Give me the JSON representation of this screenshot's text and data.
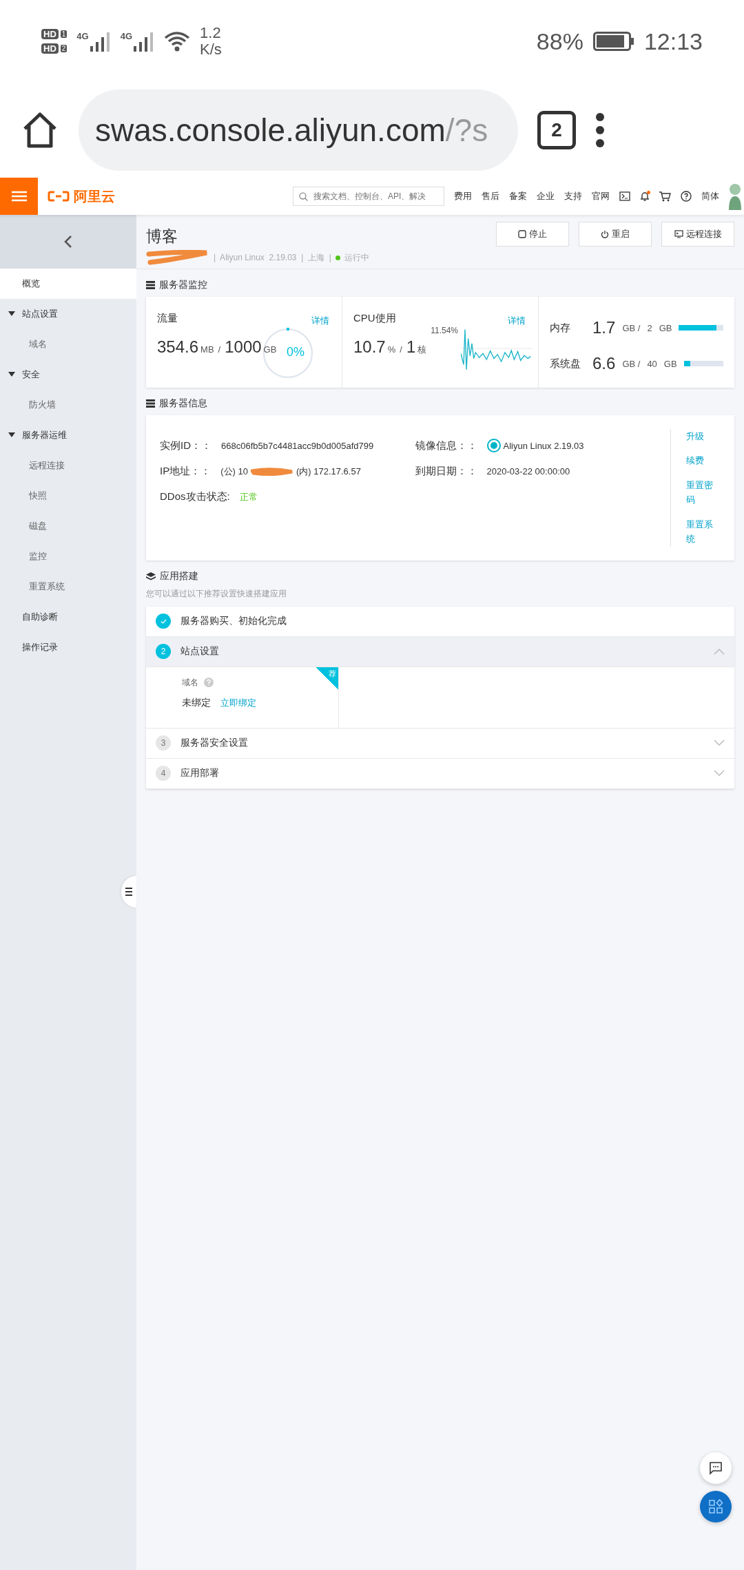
{
  "status_bar": {
    "sims": [
      {
        "badge": "HD",
        "slot": "1",
        "network": "4G"
      },
      {
        "badge": "HD",
        "slot": "2",
        "network": "4G"
      }
    ],
    "speed": "1.2",
    "speed_unit": "K/s",
    "battery": "88%",
    "time": "12:13"
  },
  "browser": {
    "url_host": "swas.console.aliyun.com",
    "url_rest": "/?s",
    "tab_count": "2"
  },
  "header": {
    "logo": "阿里云",
    "search": {
      "placeholder": "搜索文档、控制台、API、解决"
    },
    "nav": [
      "费用",
      "售后",
      "备案",
      "企业",
      "支持",
      "官网"
    ],
    "language": "简体",
    "notification_dot": true
  },
  "sidebar": {
    "items": [
      {
        "label": "概览",
        "selected": true
      },
      {
        "label": "站点设置",
        "selected": false,
        "expanded": true,
        "children": [
          {
            "label": "域名",
            "selected": false
          }
        ]
      },
      {
        "label": "安全",
        "selected": false,
        "expanded": true,
        "children": [
          {
            "label": "防火墙",
            "selected": false
          }
        ]
      },
      {
        "label": "服务器运维",
        "selected": false,
        "expanded": true,
        "children": [
          {
            "label": "远程连接",
            "selected": false
          },
          {
            "label": "快照",
            "selected": false
          },
          {
            "label": "磁盘",
            "selected": false
          },
          {
            "label": "监控",
            "selected": false
          },
          {
            "label": "重置系统",
            "selected": false
          }
        ]
      },
      {
        "label": "自助诊断",
        "selected": false
      },
      {
        "label": "操作记录",
        "selected": false
      }
    ]
  },
  "instance": {
    "title": "博客",
    "meta": "|  Aliyun Linux  2.19.03  |  上海  |",
    "status": "运行中",
    "buttons": [
      {
        "kind": "stop",
        "label": "停止"
      },
      {
        "kind": "restart",
        "label": "重启"
      },
      {
        "kind": "remote",
        "label": "远程连接"
      }
    ]
  },
  "monitor": {
    "title": "服务器监控",
    "traffic": {
      "label": "流量",
      "value": "354.6",
      "unit": "MB",
      "separator": "/",
      "total": "1000",
      "total_unit": "GB",
      "percent": "0%",
      "level": 0,
      "link": "详情"
    },
    "cpu": {
      "label": "CPU使用",
      "value": "10.7",
      "unit": "%",
      "separator": "/",
      "total": "1",
      "total_unit": "核",
      "peak": "11.54%",
      "link": "详情"
    },
    "resources": [
      {
        "label": "内存",
        "value": "1.7",
        "unit": "GB /",
        "total": "2",
        "total_unit": "GB",
        "level": 0.85
      },
      {
        "label": "系统盘",
        "value": "6.6",
        "unit": "GB /",
        "total": "40",
        "total_unit": "GB",
        "level": 0.16
      }
    ]
  },
  "info": {
    "title": "服务器信息",
    "fields": [
      {
        "kind": "text",
        "label": "实例ID：：",
        "value": "668c06fb5b7c4481acc9b0d005afd799"
      },
      {
        "kind": "image",
        "label": "镜像信息：：",
        "value": "Aliyun Linux 2.19.03"
      },
      {
        "kind": "ip",
        "label": "IP地址：：",
        "public_prefix": "(公) 10",
        "private": "(内) 172.17.6.57"
      },
      {
        "kind": "text",
        "label": "到期日期：：",
        "value": "2020-03-22 00:00:00"
      },
      {
        "kind": "status",
        "label": "DDos攻击状态:",
        "value": "正常"
      }
    ],
    "actions": [
      "升级",
      "续费",
      "重置密码",
      "重置系统"
    ]
  },
  "app_build": {
    "title": "应用搭建",
    "subtitle": "您可以通过以下推荐设置快速搭建应用",
    "steps": [
      {
        "done": true,
        "selected": false,
        "label": "服务器购买、初始化完成",
        "expanded": false
      },
      {
        "done": false,
        "selected": true,
        "number": "2",
        "label": "站点设置",
        "expanded": true,
        "detail": {
          "field": "域名",
          "value": "未绑定",
          "link": "立即绑定",
          "badge": "荐"
        }
      },
      {
        "done": false,
        "selected": false,
        "number": "3",
        "label": "服务器安全设置",
        "expanded": false
      },
      {
        "done": false,
        "selected": false,
        "number": "4",
        "label": "应用部署",
        "expanded": false
      }
    ]
  }
}
